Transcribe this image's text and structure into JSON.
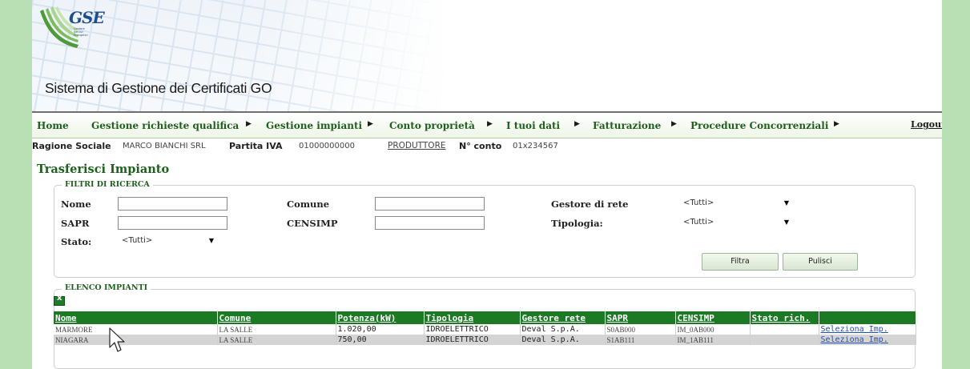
{
  "header": {
    "logo_text": "GSE",
    "logo_subtext": [
      "Gestore",
      "Servizi",
      "Energetici"
    ],
    "system_title": "Sistema di Gestione dei Certificati GO"
  },
  "menu": {
    "items": [
      {
        "label": "Home"
      },
      {
        "label": "Gestione richieste qualifica"
      },
      {
        "label": "Gestione impianti"
      },
      {
        "label": "Conto proprietà"
      },
      {
        "label": "I tuoi dati"
      },
      {
        "label": "Fatturazione"
      },
      {
        "label": "Procedure Concorrenziali"
      }
    ],
    "logout": "Logout"
  },
  "info": {
    "ragione_label": "Ragione Sociale",
    "ragione_value": "MARCO BIANCHI SRL",
    "piva_label": "Partita IVA",
    "piva_value": "01000000000",
    "role": "PRODUTTORE",
    "conto_label": "N° conto",
    "conto_value": "01x234567"
  },
  "page_title": "Trasferisci Impianto",
  "filters": {
    "legend": "FILTRI DI RICERCA",
    "nome_label": "Nome",
    "sapr_label": "SAPR",
    "stato_label": "Stato:",
    "stato_value": "<Tutti>",
    "comune_label": "Comune",
    "censimp_label": "CENSIMP",
    "gestore_label": "Gestore di rete",
    "gestore_value": "<Tutti>",
    "tipologia_label": "Tipologia:",
    "tipologia_value": "<Tutti>",
    "filtra_button": "Filtra",
    "pulisci_button": "Pulisci"
  },
  "list": {
    "legend": "ELENCO IMPIANTI",
    "columns": [
      "Nome",
      "Comune",
      "Potenza(kW)",
      "Tipologia",
      "Gestore rete",
      "SAPR",
      "CENSIMP",
      "Stato rich.",
      ""
    ],
    "rows": [
      {
        "nome": "MARMORE",
        "comune": "LA SALLE",
        "potenza": "1.020,00",
        "tipologia": "IDROELETTRICO",
        "gestore": "Deval S.p.A.",
        "sapr": "S0AB000",
        "censimp": "IM_0AB000",
        "stato": "",
        "action": "Seleziona Imp."
      },
      {
        "nome": "NIAGARA",
        "comune": "LA SALLE",
        "potenza": "750,00",
        "tipologia": "IDROELETTRICO",
        "gestore": "Deval S.p.A.",
        "sapr": "S1AB111",
        "censimp": "IM_1AB111",
        "stato": "",
        "action": "Seleziona Imp."
      }
    ]
  },
  "colors": {
    "menu_green": "#1e5f1e",
    "table_header": "#1b7a23",
    "side_background": "#b9dfb4",
    "link": "#1f4fb8"
  },
  "icons": [
    "gse-logo-icon",
    "excel-export-icon",
    "mouse-cursor-icon",
    "dropdown-caret-icon",
    "menu-arrow-icon"
  ]
}
